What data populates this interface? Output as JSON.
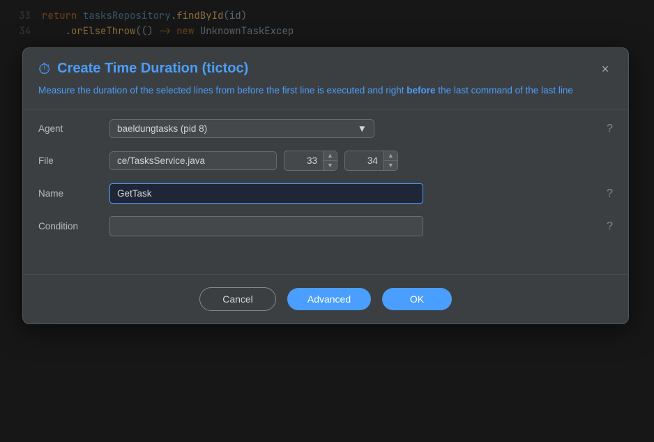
{
  "background": {
    "lines": [
      {
        "num": "33",
        "code_html": "<span class='kw-return'>return</span> <span class='obj-name'>tasksRepository</span>.<span class='method-name'>findById</span>(id)"
      },
      {
        "num": "34",
        "code_html": "&nbsp;&nbsp;&nbsp;&nbsp;.<span class='method-name'>orElseThrow</span>(() <span class='arrow'>-&gt;</span> <span class='kw-new'>new</span> UnknownTaskExcep"
      }
    ]
  },
  "dialog": {
    "title": "Create Time Duration (tictoc)",
    "description_part1": "Measure the duration of the selected lines from before the first line is executed and right ",
    "description_bold": "before",
    "description_part2": " the last command of the last line",
    "close_label": "×",
    "agent_label": "Agent",
    "agent_value": "baeldungtasks (pid 8)",
    "file_label": "File",
    "file_value": "ce/TasksService.java",
    "line_start": "33",
    "line_end": "34",
    "name_label": "Name",
    "name_value": "GetTask",
    "condition_label": "Condition",
    "condition_value": "",
    "buttons": {
      "cancel": "Cancel",
      "advanced": "Advanced",
      "ok": "OK"
    },
    "help_icon": "?"
  }
}
